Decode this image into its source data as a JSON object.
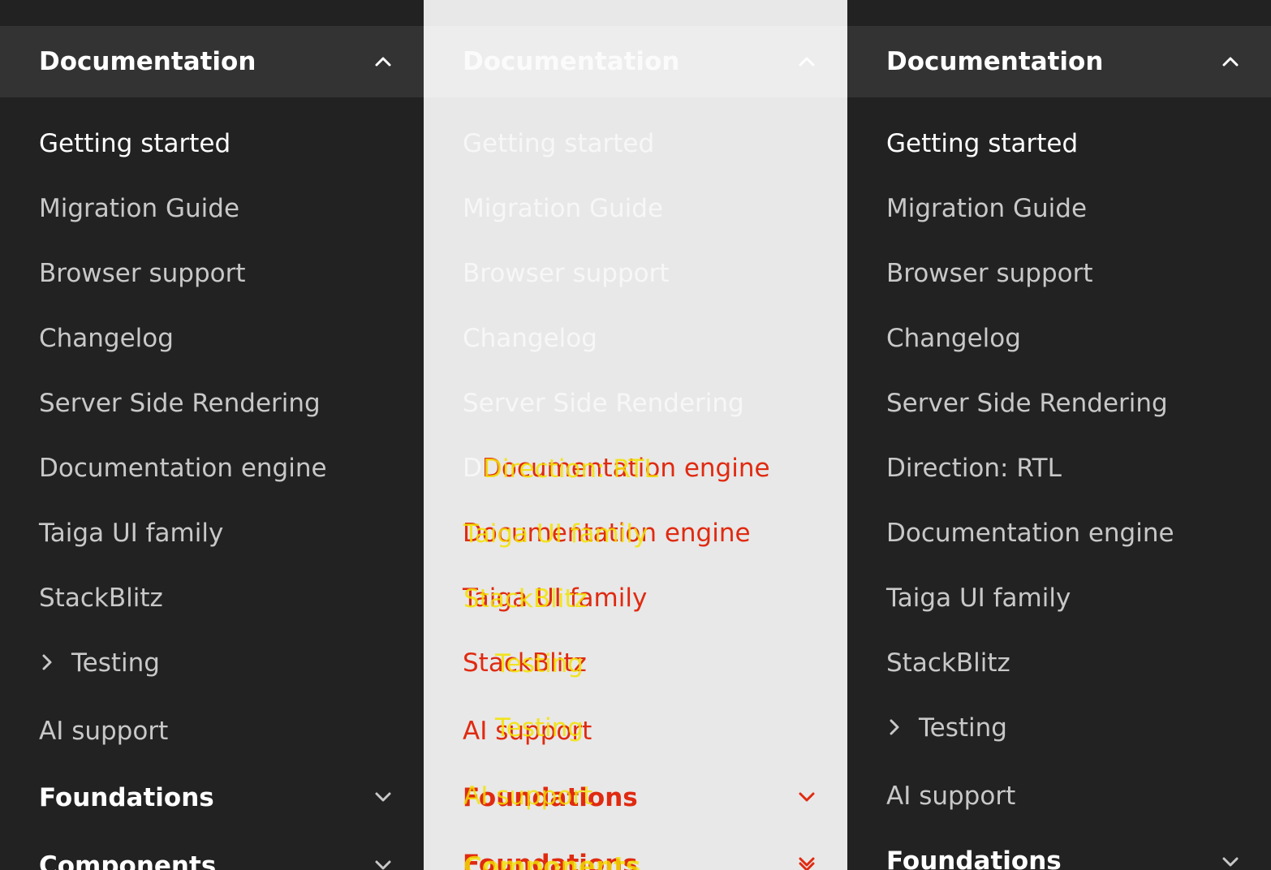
{
  "section": {
    "documentation": "Documentation",
    "foundations": "Foundations",
    "components": "Components"
  },
  "panel1": {
    "items": [
      "Getting started",
      "Migration Guide",
      "Browser support",
      "Changelog",
      "Server Side Rendering",
      "Documentation engine",
      "Taiga UI family",
      "StackBlitz",
      "Testing",
      "AI support"
    ]
  },
  "panel2": {
    "items": [
      "Getting started",
      "Migration Guide",
      "Browser support",
      "Changelog",
      "Server Side Rendering"
    ],
    "direction_prefix": "D",
    "glitch": {
      "row6_a": "Documentation engine",
      "row6_b": "Direction: RTL",
      "row7_a": "Documentation engine",
      "row7_b": "Taiga UI family",
      "row8_a": "Taiga UI family",
      "row8_b": "StackBlitz",
      "row9_a": "StackBlitz",
      "row9_b": "Testing",
      "row10_a": "AI support",
      "row10_b": "Testing",
      "row11_a": "Foundations",
      "row11_b": "AI support",
      "row12_a": "Foundations",
      "row12_b": "Components"
    }
  },
  "panel3": {
    "items": [
      "Getting started",
      "Migration Guide",
      "Browser support",
      "Changelog",
      "Server Side Rendering",
      "Direction: RTL",
      "Documentation engine",
      "Taiga UI family",
      "StackBlitz",
      "Testing",
      "AI support"
    ]
  },
  "colors": {
    "dark_bg": "#222222",
    "header_bg": "#333333",
    "light_bg": "#e8e8e8",
    "glitch_red": "#e02a10",
    "glitch_yellow": "#f3e300"
  },
  "icons": {
    "collapse": "chevron-up-icon",
    "expand": "chevron-down-icon",
    "submenu": "chevron-right-icon"
  }
}
